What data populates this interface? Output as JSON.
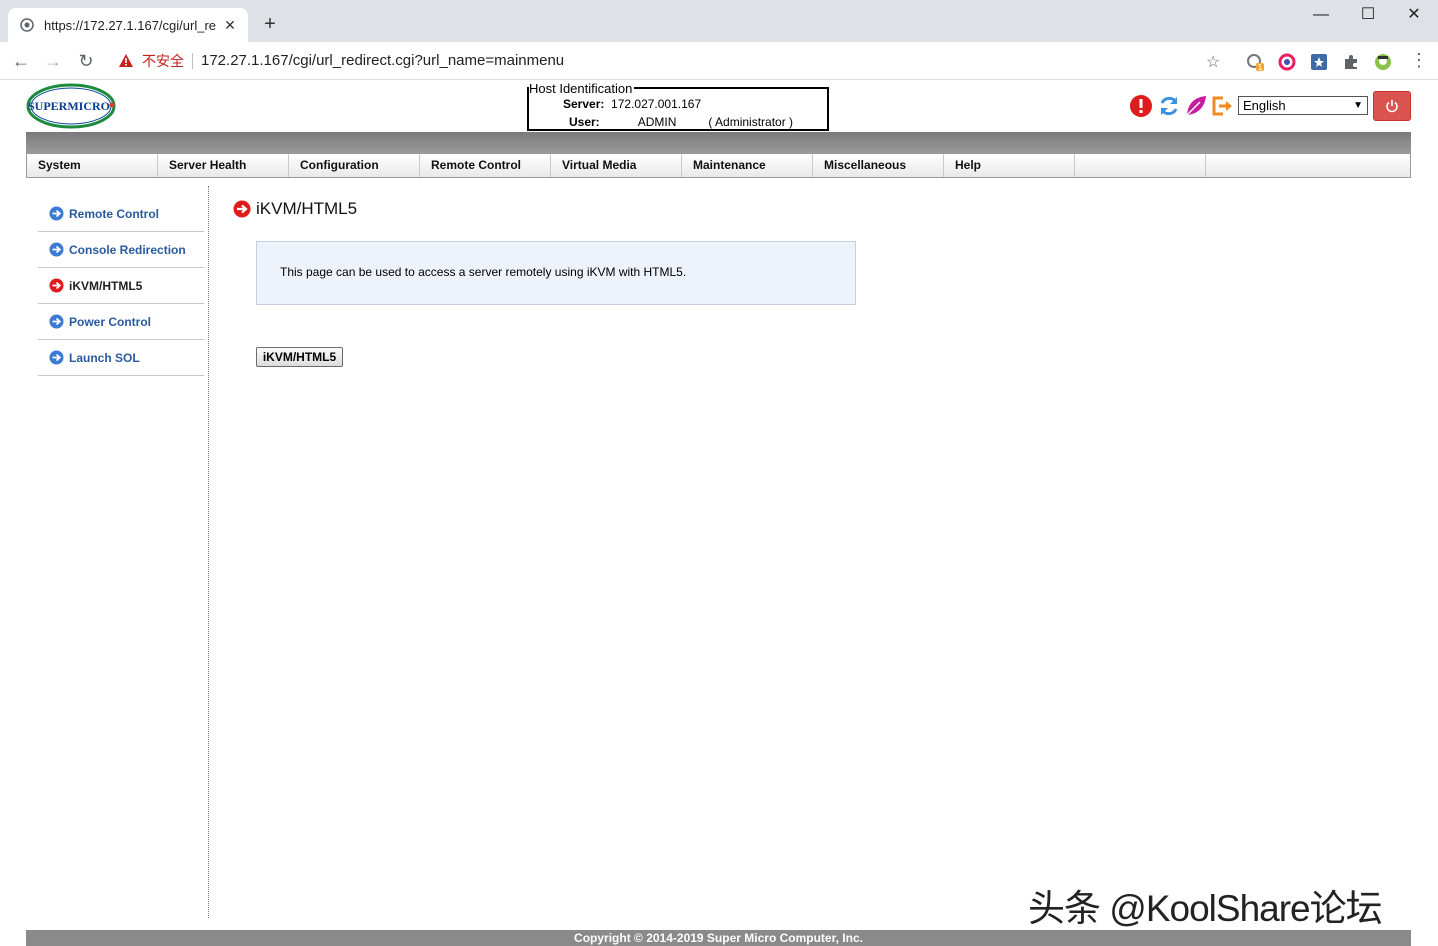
{
  "browser": {
    "tab_title": "https://172.27.1.167/cgi/url_re",
    "security_label": "不安全",
    "url": "172.27.1.167/cgi/url_redirect.cgi?url_name=mainmenu",
    "extension_badge": "1"
  },
  "header": {
    "logo_text": "SUPERMICRO",
    "host_legend": "Host Identification",
    "server_label": "Server:",
    "server_value": "172.027.001.167",
    "user_label": "User:",
    "user_value": "ADMIN",
    "user_role": "( Administrator )",
    "language_selected": "English"
  },
  "menu": [
    "System",
    "Server Health",
    "Configuration",
    "Remote Control",
    "Virtual Media",
    "Maintenance",
    "Miscellaneous",
    "Help",
    ""
  ],
  "sidebar": {
    "items": [
      {
        "label": "Remote Control",
        "active": false
      },
      {
        "label": "Console Redirection",
        "active": false
      },
      {
        "label": "iKVM/HTML5",
        "active": true
      },
      {
        "label": "Power Control",
        "active": false
      },
      {
        "label": "Launch SOL",
        "active": false
      }
    ]
  },
  "main": {
    "heading": "iKVM/HTML5",
    "description": "This page can be used to access a server remotely using iKVM with HTML5.",
    "button_label": "iKVM/HTML5"
  },
  "footer": {
    "copyright": "Copyright © 2014-2019 Super Micro Computer, Inc."
  },
  "watermark": "头条 @KoolShare论坛",
  "colors": {
    "accent_red": "#d9534f",
    "link_blue": "#2a5a9c",
    "info_bg": "#eef2fa"
  }
}
